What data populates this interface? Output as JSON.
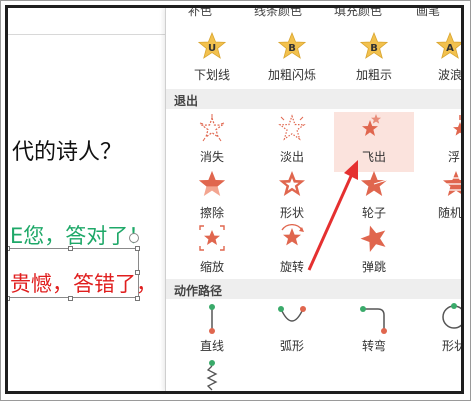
{
  "slide": {
    "question_partial": "代的诗人？",
    "correct_partial": "E您，答对了！",
    "wrong_partial": "贵憾，答错了，"
  },
  "gallery": {
    "top_row_cut": [
      "补色",
      "线条颜色",
      "填充颜色",
      "画笔"
    ],
    "emphasis_row": [
      "下划线",
      "加粗闪烁",
      "加粗示",
      "波浪"
    ],
    "exit_section": "退出",
    "exit_items": [
      "消失",
      "淡出",
      "飞出",
      "浮出",
      "擦除",
      "形状",
      "轮子",
      "随机线",
      "缩放",
      "旋转",
      "弹跳"
    ],
    "path_section": "动作路径",
    "path_items": [
      "直线",
      "弧形",
      "转弯",
      "形状"
    ],
    "hovered_item": "飞出"
  },
  "colors": {
    "exit_star": "#e0664e",
    "emphasis_star": "#f2c14e",
    "hover_bg": "#fbe3dd",
    "correct_text": "#1ea868",
    "wrong_text": "#e01e1e",
    "annotation_arrow": "#e53030"
  }
}
